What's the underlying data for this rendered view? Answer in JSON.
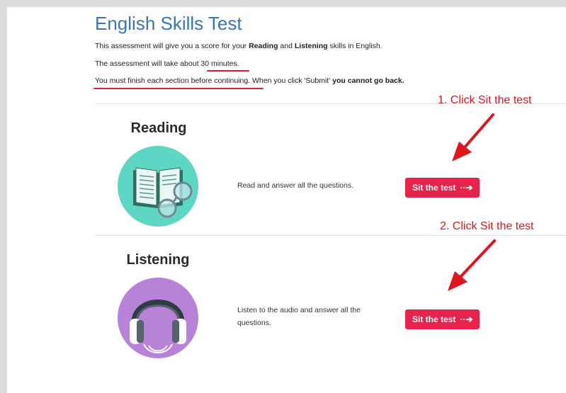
{
  "header": {
    "title": "English Skills Test",
    "intro_pre": "This assessment will give you a score for your ",
    "intro_reading": "Reading",
    "intro_and": " and ",
    "intro_listening": "Listening",
    "intro_post": " skills in English.",
    "duration_pre": "The assessment will take about ",
    "duration_value": "30 minutes",
    "duration_post": ".",
    "finish_underlined": "You must finish each section before continuing",
    "finish_mid": ". When you click 'Submit' ",
    "finish_bold": "you cannot go back."
  },
  "sections": [
    {
      "title": "Reading",
      "description": "Read and answer all the questions.",
      "button_label": "Sit the test",
      "icon": "book-magnifier-icon"
    },
    {
      "title": "Listening",
      "description": "Listen to the audio and answer all the questions.",
      "button_label": "Sit the test",
      "icon": "headphones-icon"
    }
  ],
  "annotations": {
    "step1": "1. Click Sit the test",
    "step2": "2. Click Sit the test"
  },
  "colors": {
    "title": "#3776b8",
    "button": "#e8234b",
    "annotation": "#e0141c",
    "reading_circle": "#5ed6c4",
    "listening_circle": "#b782d8"
  }
}
